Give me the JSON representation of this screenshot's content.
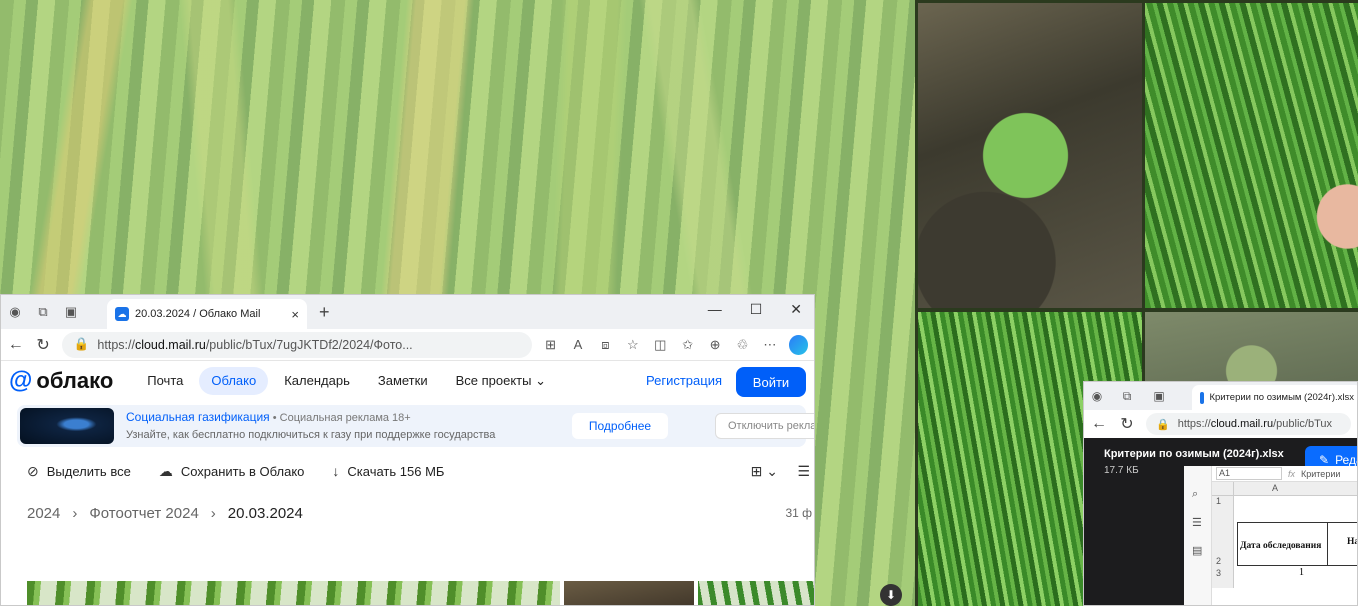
{
  "window1": {
    "tab_title": "20.03.2024 / Облако Mail",
    "tab_close": "×",
    "new_tab": "+",
    "controls": [
      "—",
      "☐",
      "✕"
    ],
    "url_prefix": "https://",
    "url_host": "cloud.mail.ru",
    "url_path": "/public/bTux/7ugJKTDf2/2024/Фото...",
    "site": {
      "logo_at": "@",
      "logo_text": "облако",
      "nav": [
        "Почта",
        "Облако",
        "Календарь",
        "Заметки",
        "Все проекты ⌄"
      ],
      "register": "Регистрация",
      "login": "Войти"
    },
    "ad": {
      "title": "Социальная газификация",
      "meta": " • Социальная реклама 18+",
      "desc": "Узнайте, как бесплатно подключиться к газу при поддержке государства",
      "more": "Подробнее",
      "disable": "Отключить рекламу"
    },
    "actions": {
      "select_all": "Выделить все",
      "save_cloud": "Сохранить в Облако",
      "download": "Скачать 156 МБ"
    },
    "breadcrumb": [
      "2024",
      "Фотоотчет 2024",
      "20.03.2024"
    ],
    "count": "31 ф"
  },
  "window2": {
    "tab_title": "Критерии по озимым (2024г).xlsx",
    "url_prefix": "https://",
    "url_host": "cloud.mail.ru",
    "url_path": "/public/bTux",
    "file_name": "Критерии по озимым (2024г).xlsx",
    "file_size": "17.7 КБ",
    "edit": "Редактировать",
    "cell_ref": "A1",
    "formula": "Критерии",
    "col_a": "A",
    "rows": [
      "1",
      "2",
      "3"
    ],
    "header_cell": "Дата обследования",
    "header_cell2": "На",
    "row3_value": "1"
  }
}
